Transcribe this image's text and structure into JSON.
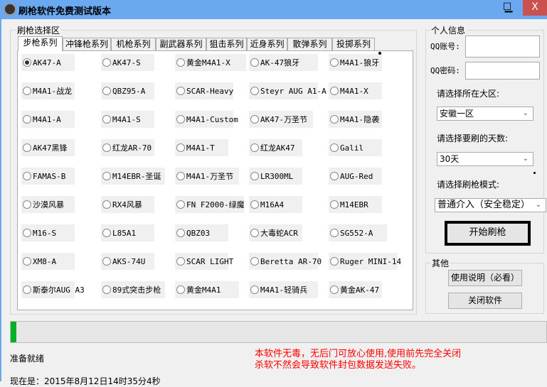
{
  "window": {
    "title": "刷枪软件免费测试版本",
    "minimize": "▁",
    "maximize": "☐",
    "close": "X"
  },
  "weapon_group": {
    "label": "刷枪选择区",
    "tabs": [
      "步枪系列",
      "冲锋枪系列",
      "机枪系列",
      "副武器系列",
      "狙击系列",
      "近身系列",
      "散弹系列",
      "投掷系列"
    ],
    "selected_tab": 0,
    "rows": [
      [
        "AK47-A",
        "AK47-S",
        "黄金M4A1-X",
        "AK-47狼牙",
        "M4A1-狼牙"
      ],
      [
        "M4A1-战龙",
        "QBZ95-A",
        "SCAR-Heavy",
        "Steyr AUG A1-A",
        "M4A1-X"
      ],
      [
        "M4A1-A",
        "M4A1-S",
        "M4A1-Custom",
        "AK47-万圣节",
        "M4A1-隐袭"
      ],
      [
        "AK47黑锋",
        "红龙AR-70",
        "M4A1-T",
        "红龙AK47",
        "Galil"
      ],
      [
        "FAMAS-B",
        "M14EBR-圣诞",
        "M4A1-万圣节",
        "LR300ML",
        "AUG-Red"
      ],
      [
        "沙漠风暴",
        "RX4风暴",
        "FN F2000-绿魔",
        "M16A4",
        "M14EBR"
      ],
      [
        "M16-S",
        "L85A1",
        "QBZ03",
        "大毒蛇ACR",
        "SG552-A"
      ],
      [
        "XM8-A",
        "AKS-74U",
        "SCAR LIGHT",
        "Beretta AR-70",
        "Ruger MINI-14"
      ],
      [
        "斯泰尔AUG A3",
        "89式突击步枪",
        "黄金M4A1",
        "M4A1-轻骑兵",
        "黄金AK-47"
      ]
    ],
    "selected": "AK47-A"
  },
  "personal": {
    "label": "个人信息",
    "qq_label": "QQ账号:",
    "qq_value": "",
    "pwd_label": "QQ密码:",
    "pwd_value": "",
    "region_label": "请选择所在大区:",
    "region_value": "安徽一区",
    "days_label": "请选择要刷的天数:",
    "days_value": "30天",
    "mode_label": "请选择刷枪模式:",
    "mode_value": "普通介入（安全稳定）",
    "start_button": "开始刷枪"
  },
  "other": {
    "label": "其他",
    "help_button": "使用说明（必看）",
    "close_button": "关闭软件"
  },
  "progress": {
    "value_percent": 1,
    "color": "#06b025"
  },
  "status": {
    "text": "准备就绪",
    "notice_line1": "本软件无毒，无后门可放心使用,使用前先完全关闭",
    "notice_line2": "杀软不然会导致软件封包数据发送失败。",
    "time": "现在是：2015年8月12日14时35分4秒",
    "notice_color": "#ff0000"
  }
}
